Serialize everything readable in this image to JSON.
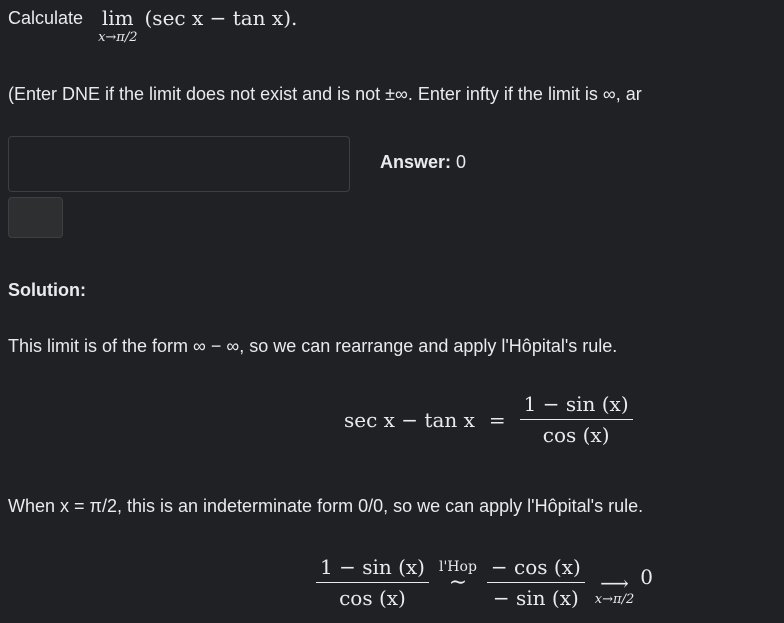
{
  "question": {
    "prefix": "Calculate",
    "lim_op": "lim",
    "lim_sub": "x→π/2",
    "expr": "(sec x − tan x)."
  },
  "instructions": "(Enter DNE if the limit does not exist and is not ±∞. Enter infty if the limit is ∞, ar",
  "answer_input": {
    "value": "",
    "placeholder": ""
  },
  "answer_label": "Answer:",
  "answer_value": "0",
  "solution": {
    "heading": "Solution:",
    "para1": "This limit is of the form ∞ − ∞, so we can rearrange and apply l'Hôpital's rule.",
    "eq1_lhs": "sec x − tan x",
    "eq1_eq": "=",
    "eq1_num": "1 − sin (x)",
    "eq1_den": "cos (x)",
    "para2": "When x = π/2, this is an indeterminate form 0/0, so we can apply l'Hôpital's rule.",
    "eq2_num1": "1 − sin (x)",
    "eq2_den1": "cos (x)",
    "eq2_hop": "l'Hop",
    "eq2_sim": "∼",
    "eq2_num2": "− cos (x)",
    "eq2_den2": "− sin (x)",
    "eq2_arrow": "⟶",
    "eq2_sub": "x→π/2",
    "eq2_result": "0"
  }
}
